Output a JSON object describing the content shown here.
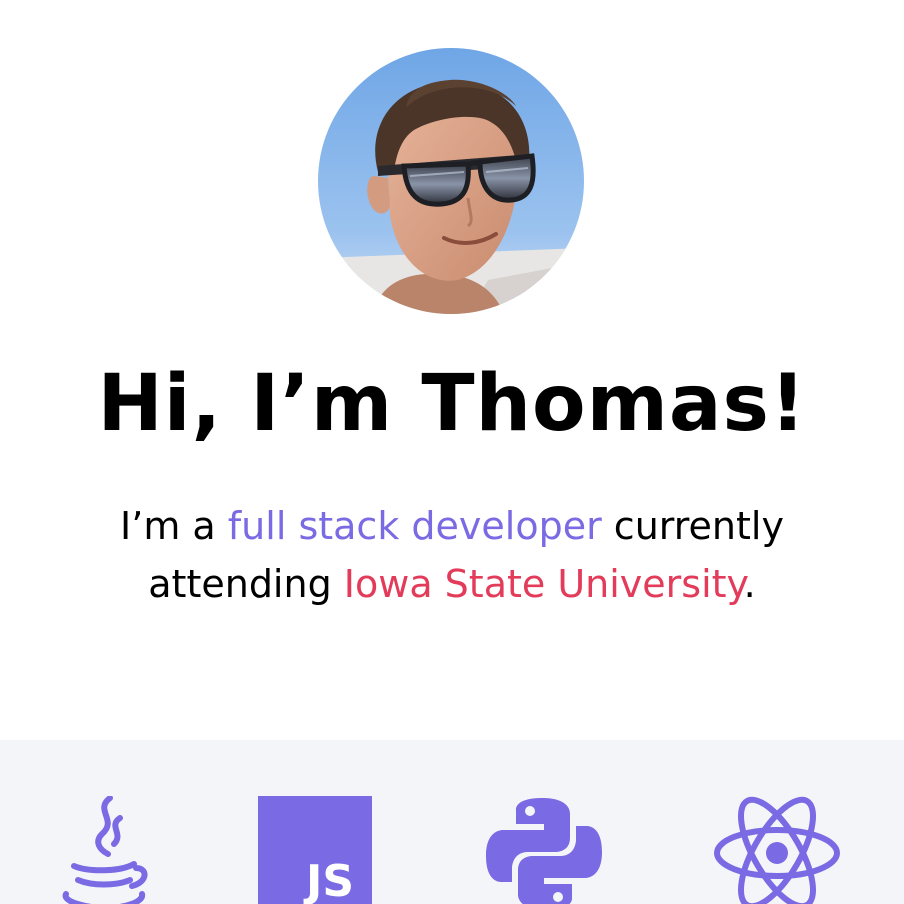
{
  "hero": {
    "title": "Hi, I’m Thomas!",
    "intro": {
      "line1_prefix": "I’m a ",
      "line1_highlight": "full stack developer",
      "line1_suffix": " currently",
      "line2_prefix": "attending ",
      "line2_highlight": "Iowa State University",
      "line2_suffix": "."
    },
    "avatar": {
      "icon": "profile-photo"
    }
  },
  "skills": {
    "items": [
      {
        "icon": "java-icon"
      },
      {
        "icon": "javascript-icon",
        "label": "JS"
      },
      {
        "icon": "python-icon"
      },
      {
        "icon": "react-icon"
      }
    ]
  },
  "colors": {
    "accent_purple": "#7a6ae3",
    "accent_red": "#e33b5a",
    "skills_background": "#f4f5f9",
    "text": "#000000",
    "background": "#ffffff"
  }
}
